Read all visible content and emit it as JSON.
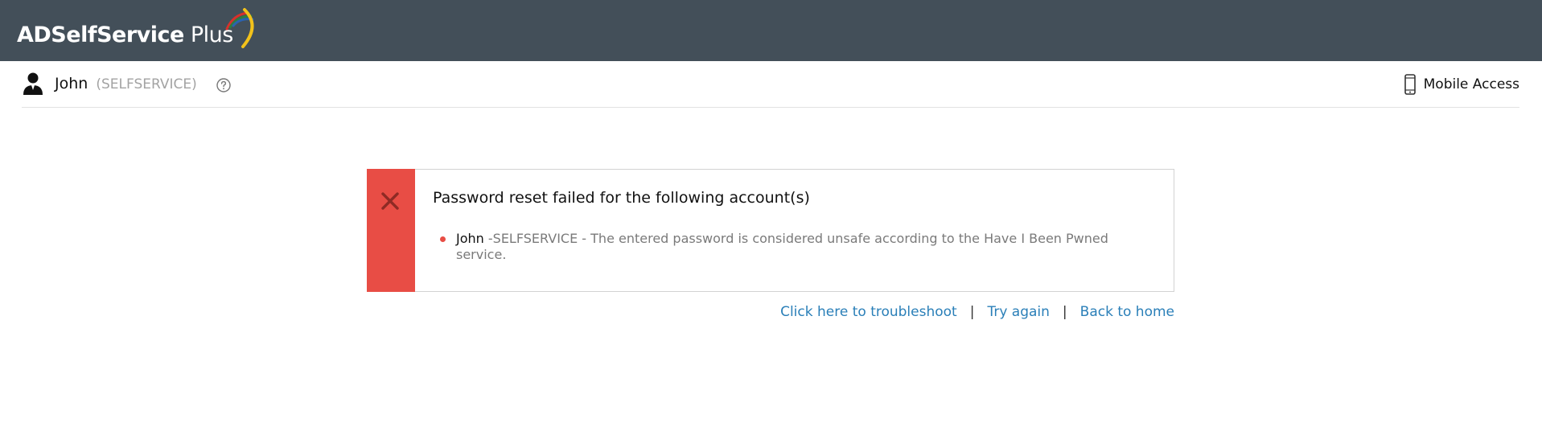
{
  "header": {
    "logo_bold": "ADSelfService",
    "logo_light": "Plus",
    "swirl_colors": [
      "#d8312b",
      "#2f7d3f",
      "#2a63b0",
      "#f2c21b"
    ]
  },
  "userbar": {
    "name": "John",
    "domain": "(SELFSERVICE)",
    "help_icon": "help-circle-icon",
    "mobile_access_label": "Mobile Access",
    "mobile_icon": "mobile-phone-icon"
  },
  "alert": {
    "status": "error",
    "accent_color": "#e84d45",
    "icon": "close-icon",
    "title": "Password reset failed for the following account(s)",
    "items": [
      {
        "user": "John",
        "message": " -SELFSERVICE - The entered password is considered unsafe according to the Have I Been Pwned service."
      }
    ]
  },
  "links": {
    "troubleshoot": "Click here to troubleshoot",
    "separator": "|",
    "try_again": "Try again",
    "back_home": "Back to home"
  }
}
